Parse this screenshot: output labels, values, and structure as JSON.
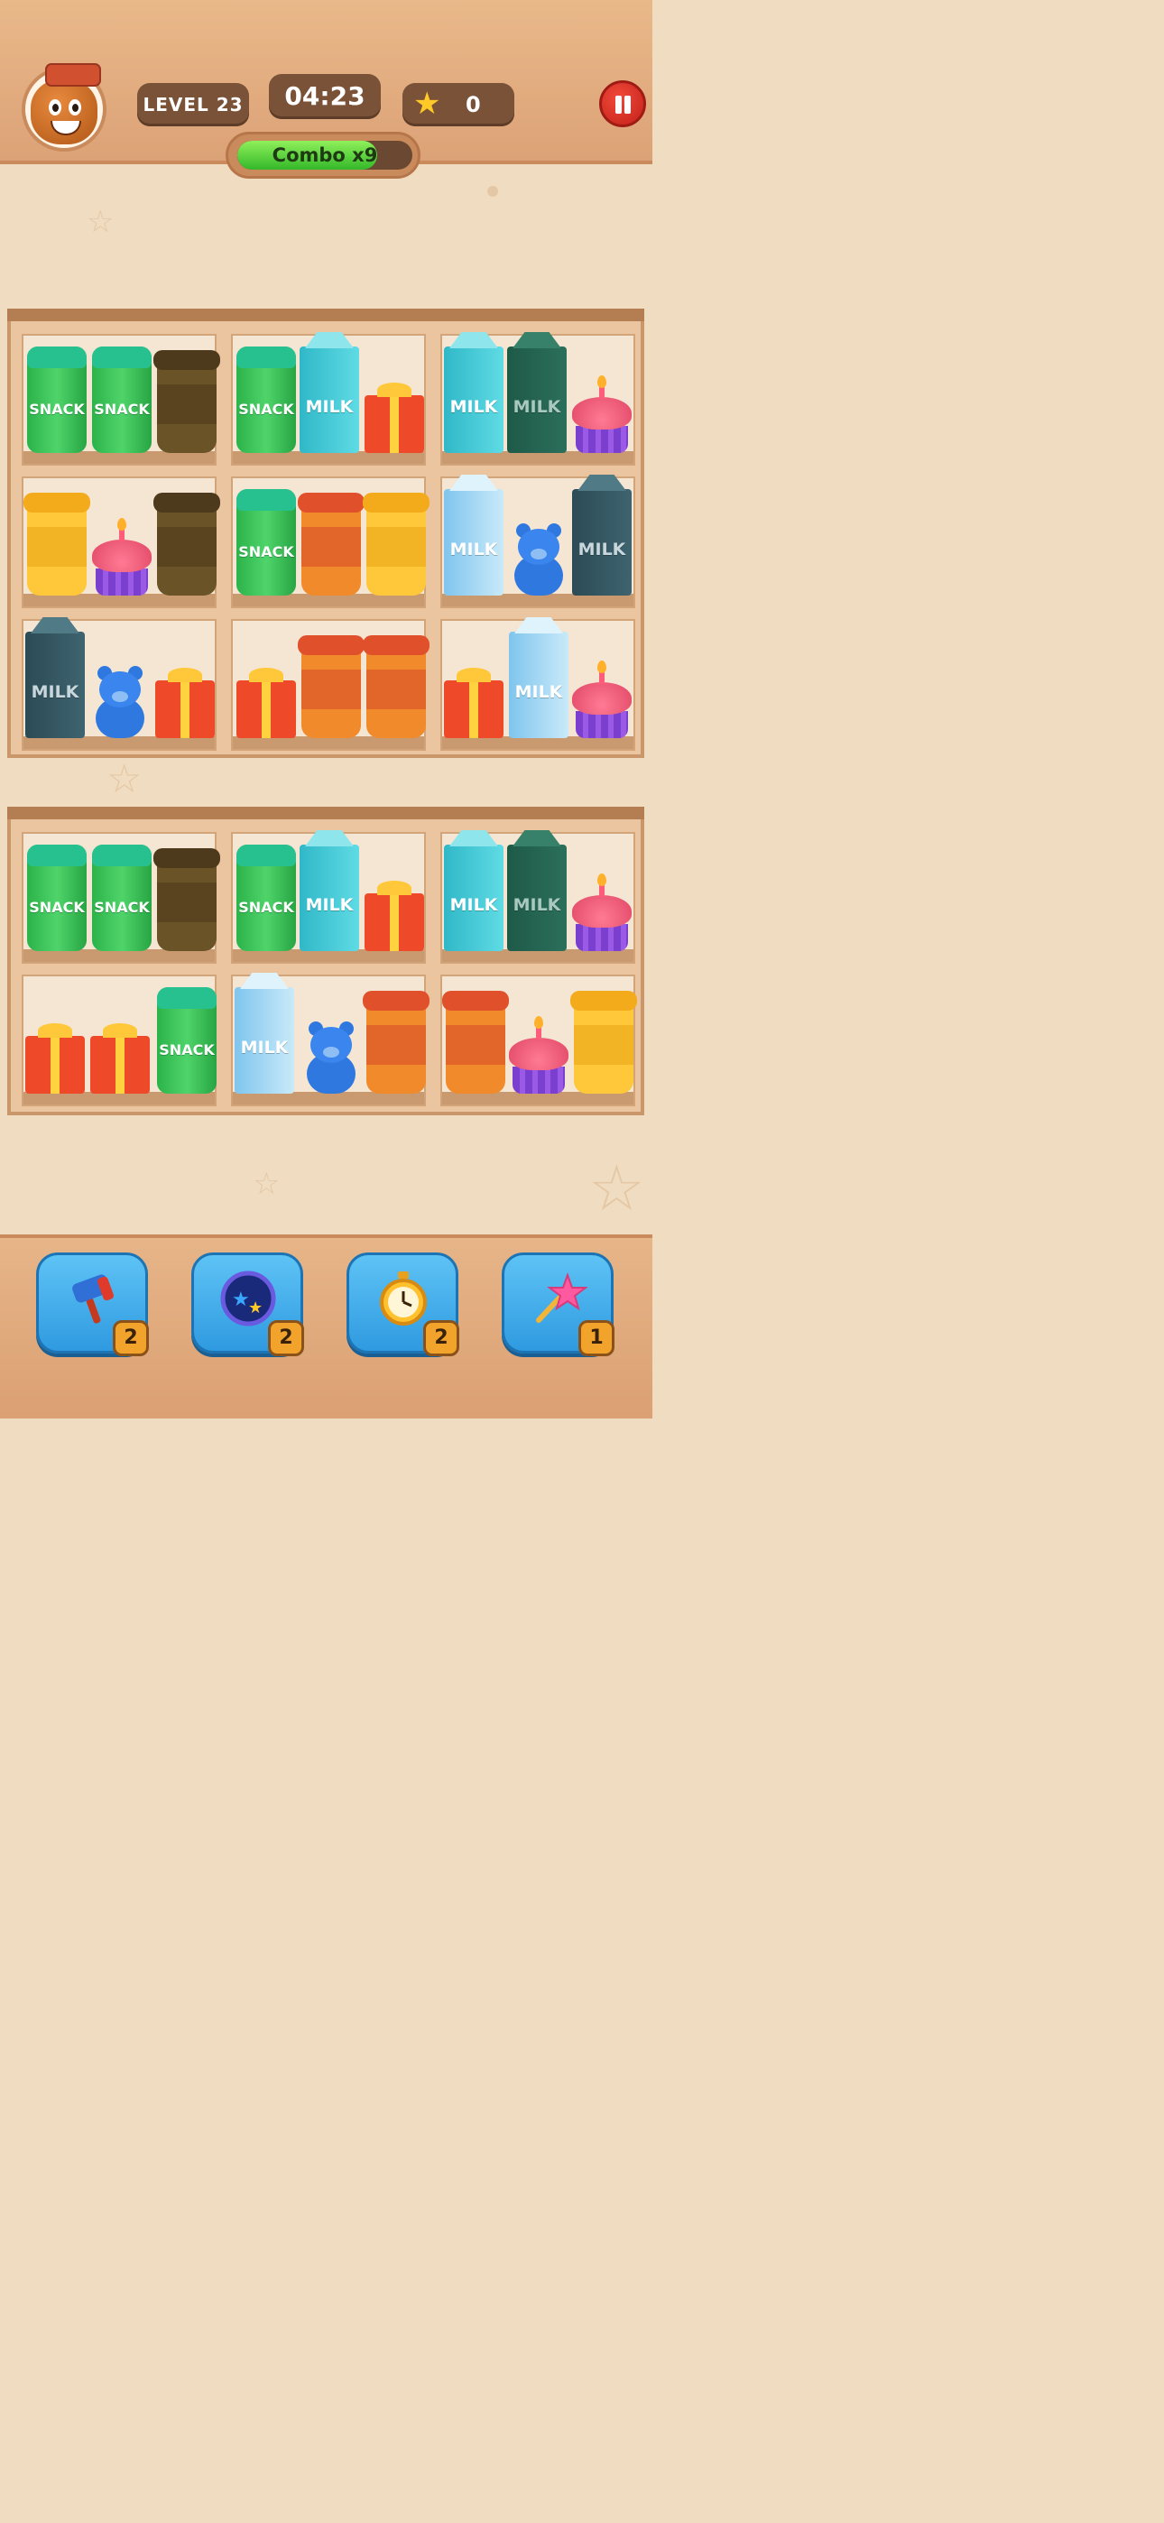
{
  "hud": {
    "level_label": "LEVEL 23",
    "timer": "04:23",
    "score": "0",
    "combo_label": "Combo x9",
    "combo_fill_fraction": 0.8
  },
  "labels": {
    "snack": "SNACK",
    "milk": "MILK"
  },
  "powerups": [
    {
      "name": "hammer",
      "count": "2"
    },
    {
      "name": "shuffle-stars",
      "count": "2"
    },
    {
      "name": "timer-freeze",
      "count": "2"
    },
    {
      "name": "magic-wand",
      "count": "1"
    }
  ],
  "colors": {
    "snack_can": "#2bb34a",
    "milk_teal": "#30b8c8",
    "gift_red": "#ee4a2a",
    "cup_orange": "#f08a2a",
    "cup_yellow": "#ffc73a",
    "cup_brown": "#6b5328",
    "bear_blue": "#2f78e0",
    "combo_green": "#4fd43a"
  }
}
